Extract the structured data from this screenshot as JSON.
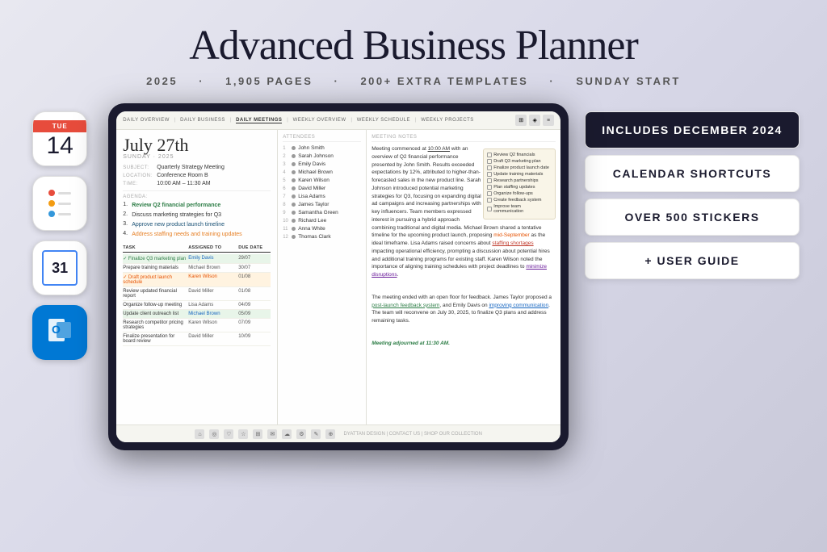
{
  "header": {
    "title": "Advanced Business Planner",
    "subtitle_parts": [
      "2025",
      "1,905 PAGES",
      "200+ EXTRA TEMPLATES",
      "SUNDAY START"
    ],
    "separator": "·"
  },
  "left_icons": [
    {
      "id": "calendar-date",
      "type": "cal",
      "day": "TUE",
      "num": "14",
      "color": "#e74c3c"
    },
    {
      "id": "reminders",
      "type": "reminders"
    },
    {
      "id": "google-calendar",
      "type": "gcal",
      "num": "31"
    },
    {
      "id": "outlook",
      "type": "outlook",
      "letter": "O"
    }
  ],
  "tablet": {
    "nav_items": [
      "DAILY OVERVIEW",
      "DAILY BUSINESS",
      "DAILY MEETINGS",
      "WEEKLY OVERVIEW",
      "WEEKLY SCHEDULE",
      "WEEKLY PROJECTS"
    ],
    "active_nav": "DAILY MEETINGS",
    "date": "July 27th",
    "date_sub": "SUNDAY · 2025",
    "subject_label": "SUBJECT:",
    "subject": "Quarterly Strategy Meeting",
    "location_label": "LOCATION:",
    "location": "Conference Room B",
    "time_label": "TIME:",
    "time": "10:00 AM – 11:30 AM",
    "agenda_label": "AGENDA:",
    "agenda_items": [
      {
        "num": "1.",
        "text": "Review Q2 financial performance",
        "style": "green"
      },
      {
        "num": "2.",
        "text": "Discuss marketing strategies for Q3",
        "style": "normal"
      },
      {
        "num": "3.",
        "text": "Approve new product launch timeline",
        "style": "blue"
      },
      {
        "num": "4.",
        "text": "Address staffing needs and training updates",
        "style": "orange"
      }
    ],
    "tasks_header": [
      "TASK",
      "ASSIGNED TO",
      "DUE DATE"
    ],
    "tasks": [
      {
        "name": "Finalize Q3 marketing plan",
        "assigned": "Emily Davis",
        "due": "29/07",
        "checked": true,
        "style": "green"
      },
      {
        "name": "Prepare training materials",
        "assigned": "Michael Brown",
        "due": "30/07",
        "checked": false,
        "style": "normal"
      },
      {
        "name": "Draft product launch schedule",
        "assigned": "Karen Wilson",
        "due": "01/08",
        "checked": true,
        "style": "orange"
      },
      {
        "name": "Review updated financial report",
        "assigned": "David Miller",
        "due": "01/08",
        "checked": false,
        "style": "normal"
      },
      {
        "name": "Organize follow-up meeting",
        "assigned": "Lisa Adams",
        "due": "04/09",
        "checked": false,
        "style": "normal"
      },
      {
        "name": "Update client outreach list",
        "assigned": "Michael Brown",
        "due": "05/09",
        "checked": false,
        "style": "green"
      },
      {
        "name": "Research competitor pricing strategies",
        "assigned": "Karen Wilson",
        "due": "07/09",
        "checked": false,
        "style": "normal"
      },
      {
        "name": "Finalize presentation for board review",
        "assigned": "David Miller",
        "due": "10/09",
        "checked": false,
        "style": "normal"
      }
    ],
    "attendees_header": "ATTENDEES",
    "attendees": [
      {
        "num": "1",
        "name": "John Smith"
      },
      {
        "num": "2",
        "name": "Sarah Johnson"
      },
      {
        "num": "3",
        "name": "Emily Davis"
      },
      {
        "num": "4",
        "name": "Michael Brown"
      },
      {
        "num": "5",
        "name": "Karen Wilson"
      },
      {
        "num": "6",
        "name": "David Miller"
      },
      {
        "num": "7",
        "name": "Lisa Adams"
      },
      {
        "num": "8",
        "name": "James Taylor"
      },
      {
        "num": "9",
        "name": "Samantha Green"
      },
      {
        "num": "10",
        "name": "Richard Lee"
      },
      {
        "num": "11",
        "name": "Anna White"
      },
      {
        "num": "12",
        "name": "Thomas Clark"
      }
    ],
    "notes_header": "MEETING NOTES",
    "notes_para1": "Meeting commenced at 10:00 AM with an overview of Q2 financial performance presented by John Smith. Results exceeded expectations by 12%, attributed to higher-than-forecasted sales in the new product line. Sarah Johnson introduced potential marketing strategies for Q3, focusing on expanding digital ad campaigns and increasing partnerships with key influencers. Team members expressed interest in pursuing a hybrid approach combining traditional and digital media. Michael Brown shared a tentative timeline for the upcoming product launch, proposing mid-September as the ideal timeframe. Lisa Adams raised concerns about staffing shortages impacting operational efficiency, prompting a discussion about potential hires and additional training programs for existing staff. Karen Wilson noted the importance of aligning training schedules with project deadlines to minimize disruptions.",
    "notes_para2": "The meeting ended with an open floor for feedback. James Taylor proposed a post-launch feedback system, and Emily Davis on improving communication. The team will reconvene on July 30, 2025, to finalize Q3 plans and address remaining tasks.",
    "notes_closing": "Meeting adjourned at 11:30 AM.",
    "checklist_items": [
      "Review Q2 financials",
      "Draft Q3 marketing plan",
      "Finalize product launch date",
      "Update training materials",
      "Research partnerships",
      "Plan staffing updates",
      "Organize follow-ups",
      "Create feedback system",
      "Improve team communication"
    ],
    "footer_label": "DYATTAN DESIGN | CONTACT US | SHOP OUR COLLECTION"
  },
  "right_badges": [
    {
      "text": "INCLUDES DECEMBER 2024",
      "dark": true
    },
    {
      "text": "CALENDAR SHORTCUTS",
      "dark": false
    },
    {
      "text": "OVER 500 STICKERS",
      "dark": false
    },
    {
      "text": "+ USER GUIDE",
      "dark": false
    }
  ]
}
